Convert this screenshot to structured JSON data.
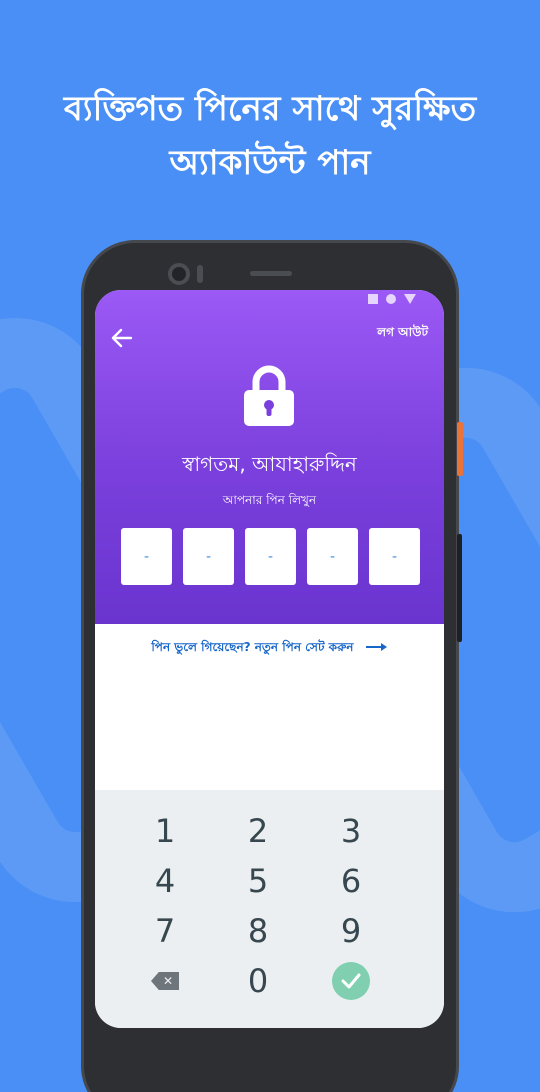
{
  "headline": {
    "line1": "ব্যক্তিগত পিনের সাথে সুরক্ষিত",
    "line2": "অ্যাকাউন্ট পান"
  },
  "status_bar": {
    "icons": [
      "square-icon",
      "circle-icon",
      "triangle-icon"
    ]
  },
  "header": {
    "back_icon": "arrow-left-icon",
    "logout_label": "লগ আউট",
    "lock_icon": "lock-icon",
    "welcome_text": "স্বাগতম, আযাহারুদ্দিন",
    "pin_prompt": "আপনার পিন লিখুন"
  },
  "pin_boxes": [
    "-",
    "-",
    "-",
    "-",
    "-"
  ],
  "forgot_link": {
    "label": "পিন ভুলে গিয়েছেন? নতুন পিন সেট করুন",
    "icon": "arrow-right-icon"
  },
  "keypad": {
    "keys": [
      "1",
      "2",
      "3",
      "4",
      "5",
      "6",
      "7",
      "8",
      "9"
    ],
    "zero": "0",
    "backspace_icon": "backspace-icon",
    "confirm_icon": "check-icon"
  },
  "colors": {
    "background": "#4a8ff5",
    "header_top": "#9b59f5",
    "header_bottom": "#6a34cf",
    "link": "#1766c9",
    "keypad_bg": "#eceff1",
    "confirm": "#7fcfb0"
  }
}
